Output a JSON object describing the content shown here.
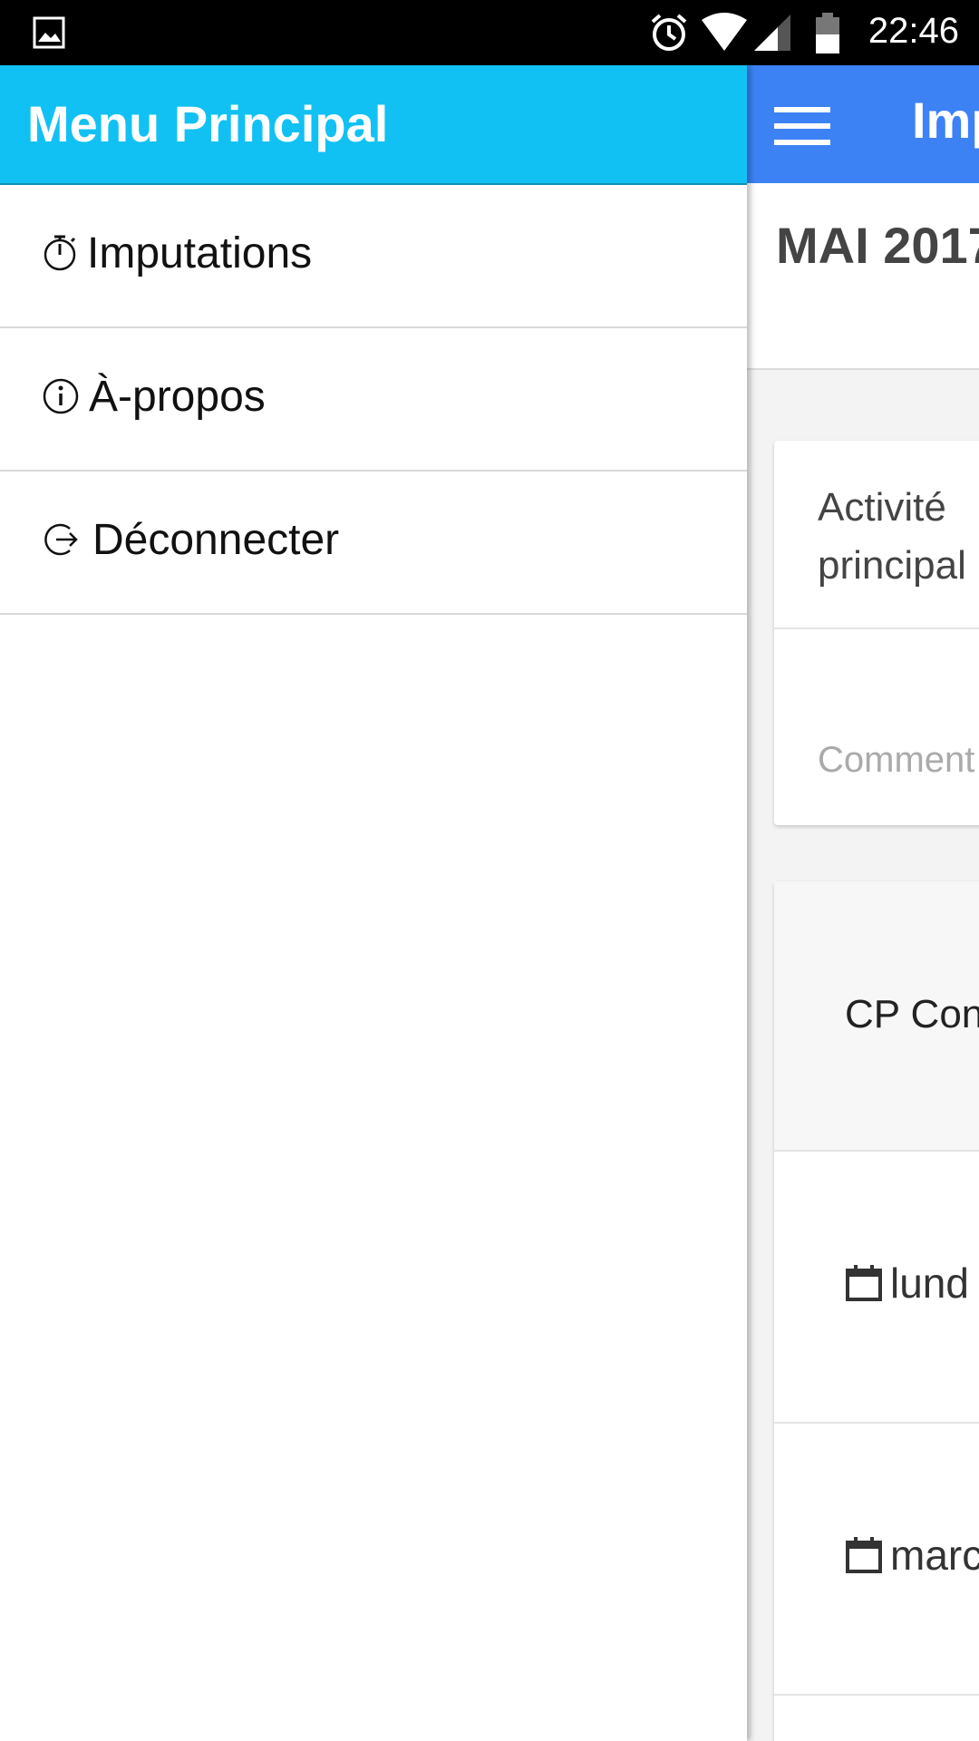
{
  "status_bar": {
    "time": "22:46",
    "icons": [
      "image-icon",
      "alarm-icon",
      "wifi-icon",
      "signal-icon",
      "battery-icon"
    ]
  },
  "drawer": {
    "title": "Menu Principal",
    "header_color": "#12c1f3",
    "items": [
      {
        "label": "Imputations",
        "icon": "stopwatch-icon"
      },
      {
        "label": "À-propos",
        "icon": "info-icon"
      },
      {
        "label": "Déconnecter",
        "icon": "logout-icon"
      }
    ]
  },
  "background_app": {
    "toolbar_color": "#3d82f5",
    "title": "Imp",
    "month": "MAI 2017",
    "activity_label": "Activité\nprincipal",
    "comment_placeholder": "Comment",
    "category": "CP Con",
    "days": [
      "lund",
      "marc"
    ]
  }
}
